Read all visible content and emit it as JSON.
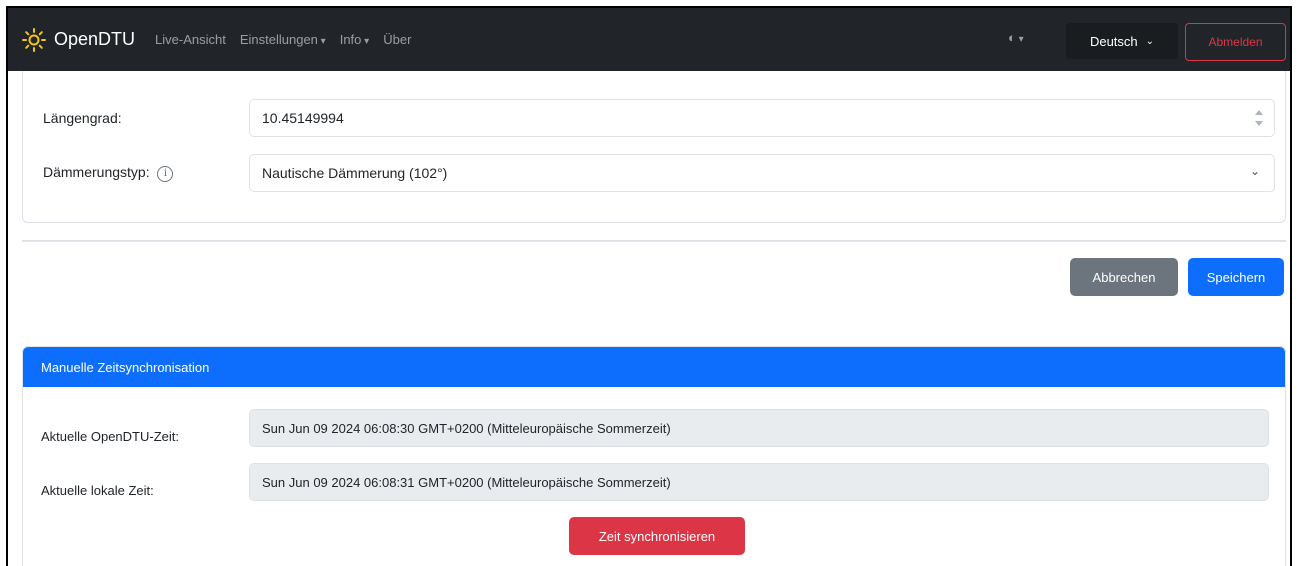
{
  "navbar": {
    "brand": "OpenDTU",
    "links": [
      {
        "label": "Live-Ansicht",
        "dropdown": false
      },
      {
        "label": "Einstellungen",
        "dropdown": true
      },
      {
        "label": "Info",
        "dropdown": true
      },
      {
        "label": "Über",
        "dropdown": false
      }
    ],
    "theme_toggle_icon": "contrast-icon",
    "language": "Deutsch",
    "logout_label": "Abmelden"
  },
  "location": {
    "longitude_label": "Längengrad:",
    "longitude_value": "10.45149994",
    "twilight_label": "Dämmerungstyp:",
    "twilight_value": "Nautische Dämmerung (102°)"
  },
  "actions": {
    "cancel_label": "Abbrechen",
    "save_label": "Speichern"
  },
  "time_sync": {
    "header": "Manuelle Zeitsynchronisation",
    "opendtu_time_label": "Aktuelle OpenDTU-Zeit:",
    "opendtu_time_value": "Sun Jun 09 2024 06:08:30 GMT+0200 (Mitteleuropäische Sommerzeit)",
    "local_time_label": "Aktuelle lokale Zeit:",
    "local_time_value": "Sun Jun 09 2024 06:08:31 GMT+0200 (Mitteleuropäische Sommerzeit)",
    "sync_button": "Zeit synchronisieren"
  },
  "colors": {
    "navbar_bg": "#212529",
    "primary": "#0d6efd",
    "secondary": "#6c757d",
    "danger": "#dc3545",
    "sun_icon": "#f5c518"
  }
}
